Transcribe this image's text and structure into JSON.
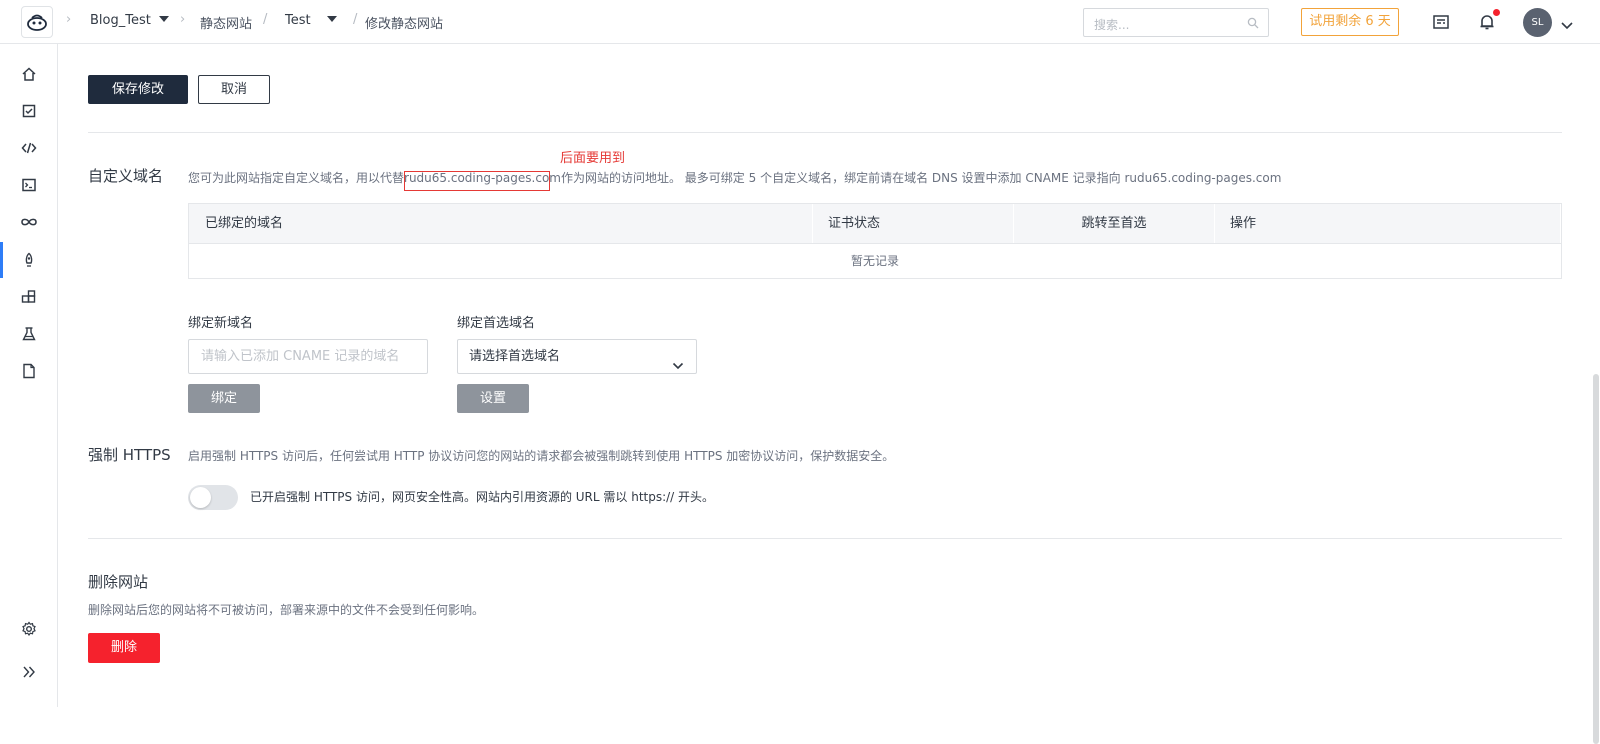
{
  "header": {
    "project": "Blog_Test",
    "crumb_static_sites": "静态网站",
    "crumb_sep": "/",
    "site_name": "Test",
    "crumb_sep2": "/",
    "page": "修改静态网站",
    "search_placeholder": "搜索...",
    "trial_label": "试用剩余 6 天",
    "avatar_initials": "SL"
  },
  "sidebar": {
    "items": [
      "home-icon",
      "task-icon",
      "code-icon",
      "terminal-icon",
      "infinity-icon",
      "rocket-icon",
      "artifact-icon",
      "flask-icon",
      "document-icon"
    ],
    "bottom": [
      "settings-icon",
      "expand-icon"
    ]
  },
  "actions": {
    "save_label": "保存修改",
    "cancel_label": "取消"
  },
  "custom_domain": {
    "title": "自定义域名",
    "desc_prefix": "您可为此网站指定自定义域名，用以代替",
    "desc_domain": "rudu65.coding-pages.com",
    "desc_suffix": "作为网站的访问地址。 最多可绑定 5 个自定义域名，绑定前请在域名 DNS 设置中添加 CNAME 记录指向 rudu65.coding-pages.com",
    "annotation": "后面要用到",
    "table_headers": [
      "已绑定的域名",
      "证书状态",
      "跳转至首选",
      "操作"
    ],
    "table_empty": "暂无记录",
    "bind_label": "绑定新域名",
    "bind_placeholder": "请输入已添加 CNAME 记录的域名",
    "bind_button": "绑定",
    "preferred_label": "绑定首选域名",
    "preferred_value": "请选择首选域名",
    "preferred_button": "设置"
  },
  "https": {
    "title": "强制 HTTPS",
    "desc": "启用强制 HTTPS 访问后，任何尝试用 HTTP 协议访问您的网站的请求都会被强制跳转到使用 HTTPS 加密协议访问，保护数据安全。",
    "toggle_text": "已开启强制 HTTPS 访问，网页安全性高。网站内引用资源的 URL 需以 https:// 开头。",
    "enabled": false
  },
  "delete_site": {
    "title": "删除网站",
    "desc": "删除网站后您的网站将不可被访问，部署来源中的文件不会受到任何影响。",
    "button": "删除"
  },
  "colors": {
    "primary": "#1f2b3d",
    "danger": "#f5222d",
    "accent": "#2e7df7",
    "trial": "#f2a33a",
    "annotation": "#e53935"
  }
}
